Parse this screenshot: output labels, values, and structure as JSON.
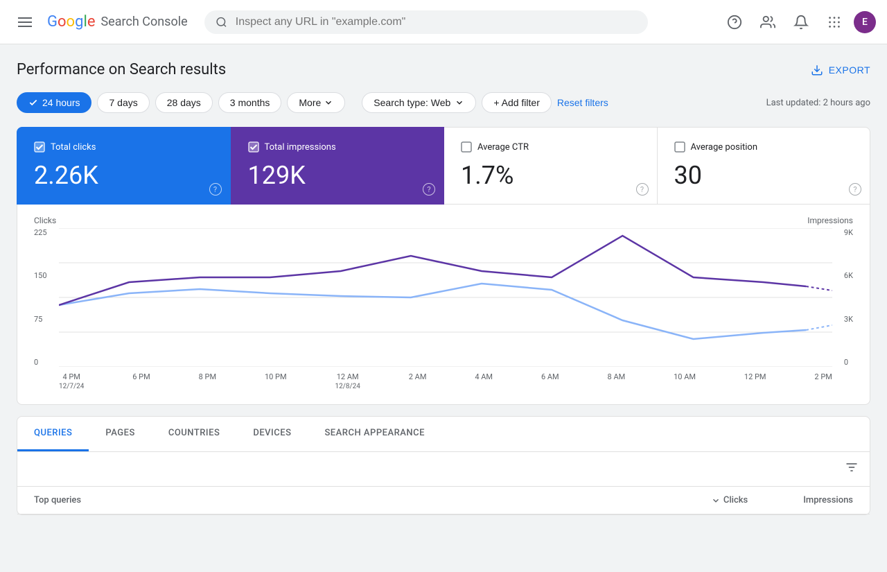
{
  "header": {
    "menu_icon": "hamburger",
    "logo": {
      "google": "Google",
      "product": "Search Console"
    },
    "search": {
      "placeholder": "Inspect any URL in \"example.com\""
    },
    "icons": {
      "help": "?",
      "users": "👤",
      "bell": "🔔",
      "grid": "⋮⋮⋮",
      "avatar": "E"
    }
  },
  "page": {
    "title": "Performance on Search results",
    "export_label": "EXPORT"
  },
  "filters": {
    "time_options": [
      {
        "label": "24 hours",
        "active": true
      },
      {
        "label": "7 days",
        "active": false
      },
      {
        "label": "28 days",
        "active": false
      },
      {
        "label": "3 months",
        "active": false
      },
      {
        "label": "More",
        "active": false,
        "has_chevron": true
      }
    ],
    "search_type": "Search type: Web",
    "add_filter": "+ Add filter",
    "reset": "Reset filters",
    "last_updated": "Last updated: 2 hours ago"
  },
  "stats": [
    {
      "label": "Total clicks",
      "value": "2.26K",
      "style": "active-blue",
      "checked": true
    },
    {
      "label": "Total impressions",
      "value": "129K",
      "style": "active-purple",
      "checked": true
    },
    {
      "label": "Average CTR",
      "value": "1.7%",
      "style": "default",
      "checked": false
    },
    {
      "label": "Average position",
      "value": "30",
      "style": "default",
      "checked": false
    }
  ],
  "chart": {
    "y_left_label": "Clicks",
    "y_right_label": "Impressions",
    "y_left_values": [
      "225",
      "150",
      "75",
      "0"
    ],
    "y_right_values": [
      "9K",
      "6K",
      "3K",
      "0"
    ],
    "x_labels": [
      {
        "time": "4 PM",
        "date": "12/7/24"
      },
      {
        "time": "6 PM",
        "date": ""
      },
      {
        "time": "8 PM",
        "date": ""
      },
      {
        "time": "10 PM",
        "date": ""
      },
      {
        "time": "12 AM",
        "date": "12/8/24"
      },
      {
        "time": "2 AM",
        "date": ""
      },
      {
        "time": "4 AM",
        "date": ""
      },
      {
        "time": "6 AM",
        "date": ""
      },
      {
        "time": "8 AM",
        "date": ""
      },
      {
        "time": "10 AM",
        "date": ""
      },
      {
        "time": "12 PM",
        "date": ""
      },
      {
        "time": "2 PM",
        "date": ""
      }
    ],
    "clicks_color": "#8ab4f8",
    "impressions_color": "#5c35a5"
  },
  "tabs": {
    "items": [
      {
        "label": "QUERIES",
        "active": true
      },
      {
        "label": "PAGES",
        "active": false
      },
      {
        "label": "COUNTRIES",
        "active": false
      },
      {
        "label": "DEVICES",
        "active": false
      },
      {
        "label": "SEARCH APPEARANCE",
        "active": false
      }
    ],
    "table": {
      "col_left": "Top queries",
      "col_clicks": "Clicks",
      "col_impressions": "Impressions"
    }
  }
}
